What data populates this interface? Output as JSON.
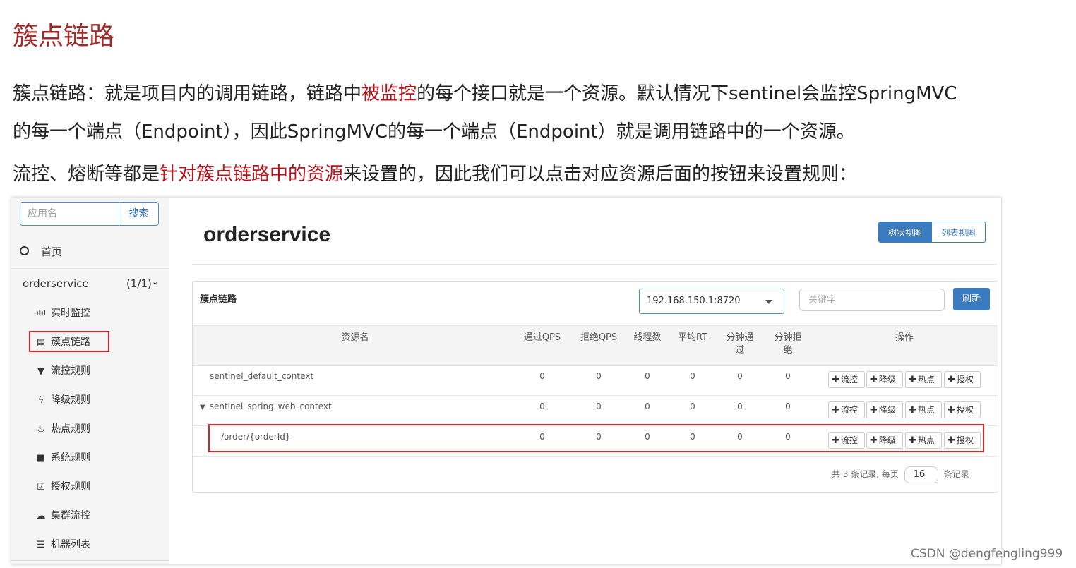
{
  "article": {
    "title": "簇点链路",
    "p1_a": "簇点链路：就是项目内的调用链路，链路中",
    "p1_hl": "被监控",
    "p1_b": "的每个接口就是一个资源。默认情况下sentinel会监控SpringMVC",
    "p2": "的每一个端点（Endpoint），因此SpringMVC的每一个端点（Endpoint）就是调用链路中的一个资源。",
    "p3_a": "流控、熔断等都是",
    "p3_hl": "针对簇点链路中的资源",
    "p3_b": "来设置的，因此我们可以点击对应资源后面的按钮来设置规则："
  },
  "sidebar": {
    "search_placeholder": "应用名",
    "search_button": "搜索",
    "home": "首页",
    "app_name": "orderservice",
    "app_count": "(1/1)",
    "app_chevron": "⌄",
    "items": [
      {
        "label": "实时监控",
        "icon": "bar-chart-icon",
        "glyph": "ılıl"
      },
      {
        "label": "簇点链路",
        "icon": "list-icon",
        "glyph": "▤"
      },
      {
        "label": "流控规则",
        "icon": "filter-icon",
        "glyph": "▼"
      },
      {
        "label": "降级规则",
        "icon": "bolt-icon",
        "glyph": "ϟ"
      },
      {
        "label": "热点规则",
        "icon": "fire-icon",
        "glyph": "♨"
      },
      {
        "label": "系统规则",
        "icon": "lock-icon",
        "glyph": "■"
      },
      {
        "label": "授权规则",
        "icon": "check-square-icon",
        "glyph": "☑"
      },
      {
        "label": "集群流控",
        "icon": "cloud-icon",
        "glyph": "☁"
      },
      {
        "label": "机器列表",
        "icon": "list-view-icon",
        "glyph": "☰"
      }
    ]
  },
  "main": {
    "title": "orderservice",
    "view_tree": "树状视图",
    "view_list": "列表视图",
    "panel_title": "簇点链路",
    "machine": "192.168.150.1:8720",
    "keyword_placeholder": "关键字",
    "refresh": "刷新"
  },
  "table": {
    "headers": {
      "resource": "资源名",
      "pass_qps": "通过QPS",
      "block_qps": "拒绝QPS",
      "threads": "线程数",
      "avg_rt": "平均RT",
      "min_pass": "分钟通过",
      "min_block": "分钟拒绝",
      "ops": "操作"
    },
    "rows": [
      {
        "name": "sentinel_default_context",
        "arrow": "",
        "pass_qps": "0",
        "block_qps": "0",
        "threads": "0",
        "avg_rt": "0",
        "min_pass": "0",
        "min_block": "0"
      },
      {
        "name": "sentinel_spring_web_context",
        "arrow": "▼",
        "pass_qps": "0",
        "block_qps": "0",
        "threads": "0",
        "avg_rt": "0",
        "min_pass": "0",
        "min_block": "0"
      },
      {
        "name": "/order/{orderId}",
        "arrow": "",
        "pass_qps": "0",
        "block_qps": "0",
        "threads": "0",
        "avg_rt": "0",
        "min_pass": "0",
        "min_block": "0"
      }
    ],
    "ops": {
      "plus": "✚",
      "flow": "流控",
      "degrade": "降级",
      "hot": "热点",
      "auth": "授权"
    },
    "pager": {
      "prefix": "共 3 条记录, 每页",
      "page_size": "16",
      "suffix": "条记录"
    }
  },
  "watermark": "CSDN @dengfengling999",
  "colors": {
    "accent": "#3a7bbf",
    "highlight_red": "#d9252b",
    "title_red": "#a52a2a"
  }
}
